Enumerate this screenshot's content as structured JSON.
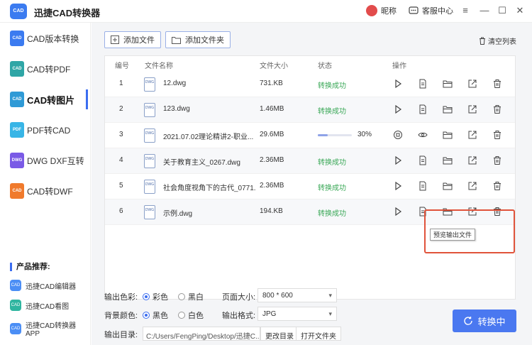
{
  "titlebar": {
    "logo_text": "CAD",
    "app_title": "迅捷CAD转换器",
    "nickname": "昵称",
    "service": "客服中心",
    "menu_icon": "≡",
    "minimize_icon": "—",
    "maximize_icon": "☐",
    "close_icon": "✕"
  },
  "sidebar": {
    "items": [
      {
        "label": "CAD版本转换",
        "icon_text": "CAD",
        "color": "#3b7bf0"
      },
      {
        "label": "CAD转PDF",
        "icon_text": "CAD",
        "color": "#2fa6a6"
      },
      {
        "label": "CAD转图片",
        "icon_text": "CAD",
        "color": "#2f9ad6"
      },
      {
        "label": "PDF转CAD",
        "icon_text": "PDF",
        "color": "#38b5e6"
      },
      {
        "label": "DWG DXF互转",
        "icon_text": "DWG",
        "color": "#7a5ae6"
      },
      {
        "label": "CAD转DWF",
        "icon_text": "CAD",
        "color": "#f07a2c"
      }
    ],
    "rec_title": "产品推荐:",
    "rec_items": [
      {
        "label": "迅捷CAD编辑器",
        "icon_text": "CAD"
      },
      {
        "label": "迅捷CAD看图",
        "icon_text": "CAD"
      },
      {
        "label": "迅捷CAD转换器APP",
        "icon_text": "CAD"
      }
    ]
  },
  "toolbar": {
    "add_file": "添加文件",
    "add_folder": "添加文件夹",
    "clear_list": "清空列表"
  },
  "table": {
    "headers": {
      "num": "编号",
      "name": "文件名称",
      "size": "文件大小",
      "status": "状态",
      "ops": "操作"
    },
    "rows": [
      {
        "num": "1",
        "name": "12.dwg",
        "size": "731.KB",
        "status": "转换成功"
      },
      {
        "num": "2",
        "name": "123.dwg",
        "size": "1.46MB",
        "status": "转换成功"
      },
      {
        "num": "3",
        "name": "2021.07.02理论精讲2-职业...",
        "size": "29.6MB",
        "status": "",
        "progress": 0.3,
        "pct": "30%"
      },
      {
        "num": "4",
        "name": "关于教育主义_0267.dwg",
        "size": "2.36MB",
        "status": "转换成功"
      },
      {
        "num": "5",
        "name": "社会角度视角下的古代_0771...",
        "size": "2.36MB",
        "status": "转换成功"
      },
      {
        "num": "6",
        "name": "示例.dwg",
        "size": "194.KB",
        "status": "转换成功"
      }
    ],
    "file_icon_text": "DWG",
    "tooltip": "预览输出文件"
  },
  "settings": {
    "color_label": "输出色彩:",
    "color_opt1": "彩色",
    "color_opt2": "黑白",
    "page_label": "页面大小:",
    "page_value": "800 * 600",
    "bg_label": "背景颜色:",
    "bg_opt1": "黑色",
    "bg_opt2": "白色",
    "format_label": "输出格式:",
    "format_value": "JPG",
    "dir_label": "输出目录:",
    "dir_value": "C:/Users/FengPing/Desktop/迅捷C...",
    "change_dir": "更改目录",
    "open_folder": "打开文件夹",
    "convert": "转换中"
  }
}
